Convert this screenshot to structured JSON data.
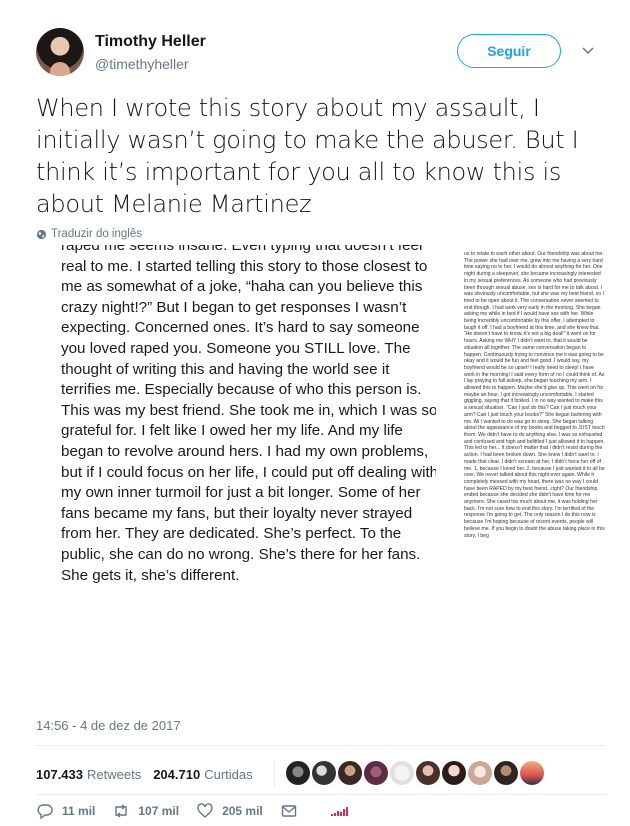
{
  "author": {
    "name": "Timothy Heller",
    "handle": "@timethyheller"
  },
  "header": {
    "follow_label": "Seguir"
  },
  "tweet": {
    "text": "When I wrote this story about my assault, I initially wasn’t going to make the abuser. But I think it’s important for you all to know this is about Melanie Martinez",
    "translate_label": "Traduzir do inglês",
    "timestamp": "14:56 - 4 de dez de 2017"
  },
  "media": {
    "left_page_text": "raped me seems insane. Even typing that doesn’t feel real to me. I started telling this story to those closest to me as somewhat of a joke, “haha can you believe this crazy night!?” But I began to get responses I wasn’t expecting. Concerned ones. It’s hard to say someone you loved raped you. Someone you STILL love. The thought of writing this and having the world see it terrifies me. Especially because of who this person is. This was my best friend. She took me in, which I was so grateful for. I felt like I owed her my life. And my life began to revolve around hers. I had my own problems, but if I could focus on her life, I could put off dealing with my own inner turmoil for just a bit longer. Some of her fans became my fans, but their loyalty never strayed from her. They are dedicated. She’s perfect. To the public, she can do no wrong. She’s there for her fans. She gets it, she’s different.",
    "right_page_text": "us to relate to each other about. Our friendship was about her. The power she had over me, grew into me having a very hard time saying no to her. I would do almost anything for her. One night during a sleepover, she became increasingly interested in my sexual preferences. As someone who had previously been through sexual abuse, sex is hard for me to talk about. I was obviously uncomfortable, but she was my best friend, so I tried to be open about it. The conversation never seemed to end though. I had work very early in the morning. She began asking me while in bed if I would have sex with her. While being incredibly uncomfortable by this offer, I attempted to laugh it off. I had a boyfriend at this time, and she knew that. “He doesn’t have to know, it’s not a big deal!” it went on for hours. Asking me WHY I didn’t want to, that it would be situation all together. The same conversation began to happen. Continuously trying to convince me it was going to be okay and it would be fun and feel good. I would say, my boyfriend would be so upset! I really need to sleep! I have work in the morning! I said every form of no I could think of. As I lay praying to fall asleep, she began touching my arm. I allowed this to happen. Maybe she’d give up. This went on for maybe an hour. I got increasingly uncomfortable. I started giggling, saying that it tickled. I in no way wanted to make this a sexual situation. “Can I just do this? Can I just touch your arm? Can I just touch your boobs?” She began bartering with me. All I wanted to do was go to sleep. She began talking about the appearance of my boobs and begged to JUST touch them. We didn’t have to do anything else. I was so exhausted and confused and high and belittled I just allowed it to happen. This led to her... It doesn’t matter that I didn’t resist during the action. I had been broken down. She knew I didn’t want to. I made that clear. I didn’t scream at her, I didn’t force her off of me. 1, because I loved her. 2, because I just wanted it to all be over. We never talked about this night ever again. While it completely messed with my head, there was no way I could have been RAPED by my best friend...right? Our friendship ended because she decided she didn’t have time for me anymore. She cared too much about me, it was holding her back. I’m not sure how to end this story. I’m terrified of the response I’m going to get. The only reason I do this now is because I’m hoping because of recent events, people will believe me. If you begin to doubt the abuse taking place in this story, I beg"
  },
  "stats": {
    "retweets_count": "107.433",
    "retweets_label": "Retweets",
    "likes_count": "204.710",
    "likes_label": "Curtidas"
  },
  "actions": {
    "replies": "11 mil",
    "retweets": "107 mil",
    "likes": "205 mil"
  },
  "colors": {
    "accent": "#1da1f2",
    "muted": "#657786",
    "text": "#14171a",
    "analytics": "#e0245e"
  }
}
